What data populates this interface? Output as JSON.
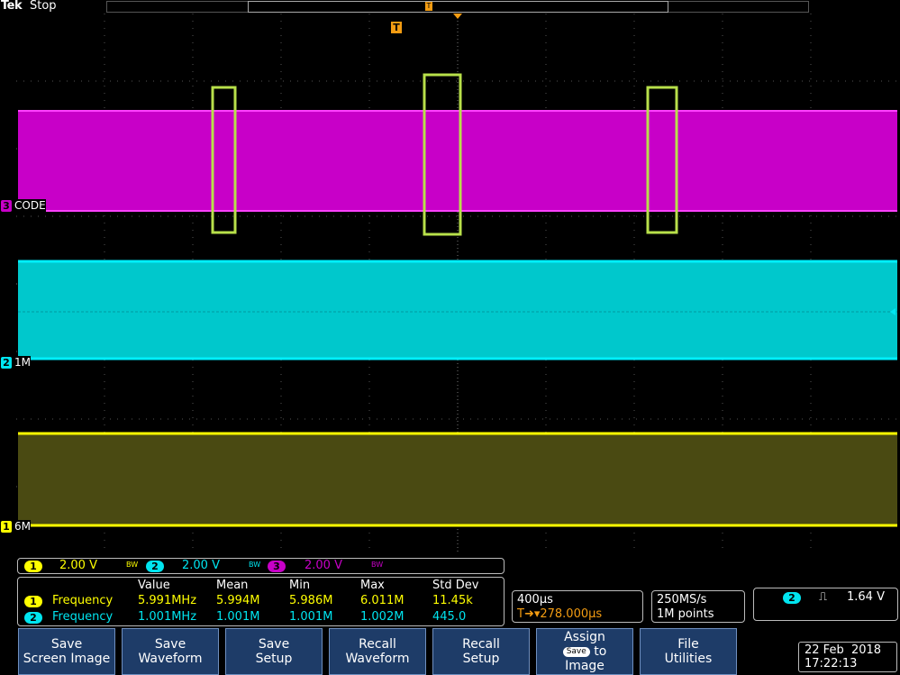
{
  "top": {
    "brand": "Tek",
    "status": "Stop",
    "trigger_glyph": "T"
  },
  "trigger_marker": "T",
  "channels": [
    {
      "num": "1",
      "label": "6M",
      "color": "#ffff00",
      "volts": "2.00 V",
      "bw": "BW"
    },
    {
      "num": "2",
      "label": "1M",
      "color": "#00e5f0",
      "volts": "2.00 V",
      "bw": "BW"
    },
    {
      "num": "3",
      "label": "CODE",
      "color": "#c800c8",
      "volts": "2.00 V",
      "bw": "BW"
    }
  ],
  "measurements": {
    "headers": [
      "Value",
      "Mean",
      "Min",
      "Max",
      "Std Dev"
    ],
    "rows": [
      {
        "ch": "1",
        "name": "Frequency",
        "value": "5.991MHz",
        "mean": "5.994M",
        "min": "5.986M",
        "max": "6.011M",
        "std": "11.45k"
      },
      {
        "ch": "2",
        "name": "Frequency",
        "value": "1.001MHz",
        "mean": "1.001M",
        "min": "1.001M",
        "max": "1.002M",
        "std": "445.0"
      }
    ]
  },
  "timebase": {
    "scale": "400µs",
    "delay": "278.000µs",
    "delay_prefix": "T➜▾"
  },
  "acquisition": {
    "rate": "250MS/s",
    "points": "1M points"
  },
  "trigger": {
    "ch": "2",
    "slope": "⎍",
    "level": "1.64 V"
  },
  "buttons": [
    {
      "line1": "Save",
      "line2": "Screen Image"
    },
    {
      "line1": "Save",
      "line2": "Waveform"
    },
    {
      "line1": "Save",
      "line2": "Setup"
    },
    {
      "line1": "Recall",
      "line2": "Waveform"
    },
    {
      "line1": "Recall",
      "line2": "Setup"
    },
    {
      "line1": "Assign",
      "pill": "Save",
      "mid": "to",
      "line2": "Image"
    },
    {
      "line1": "File",
      "line2": "Utilities"
    }
  ],
  "datetime": {
    "date": "22 Feb  2018",
    "time": "17:22:13"
  },
  "colors": {
    "ch1_fill": "#4a4a12",
    "highlight_box": "#b8e04a",
    "button_bg": "#1e3c68"
  }
}
